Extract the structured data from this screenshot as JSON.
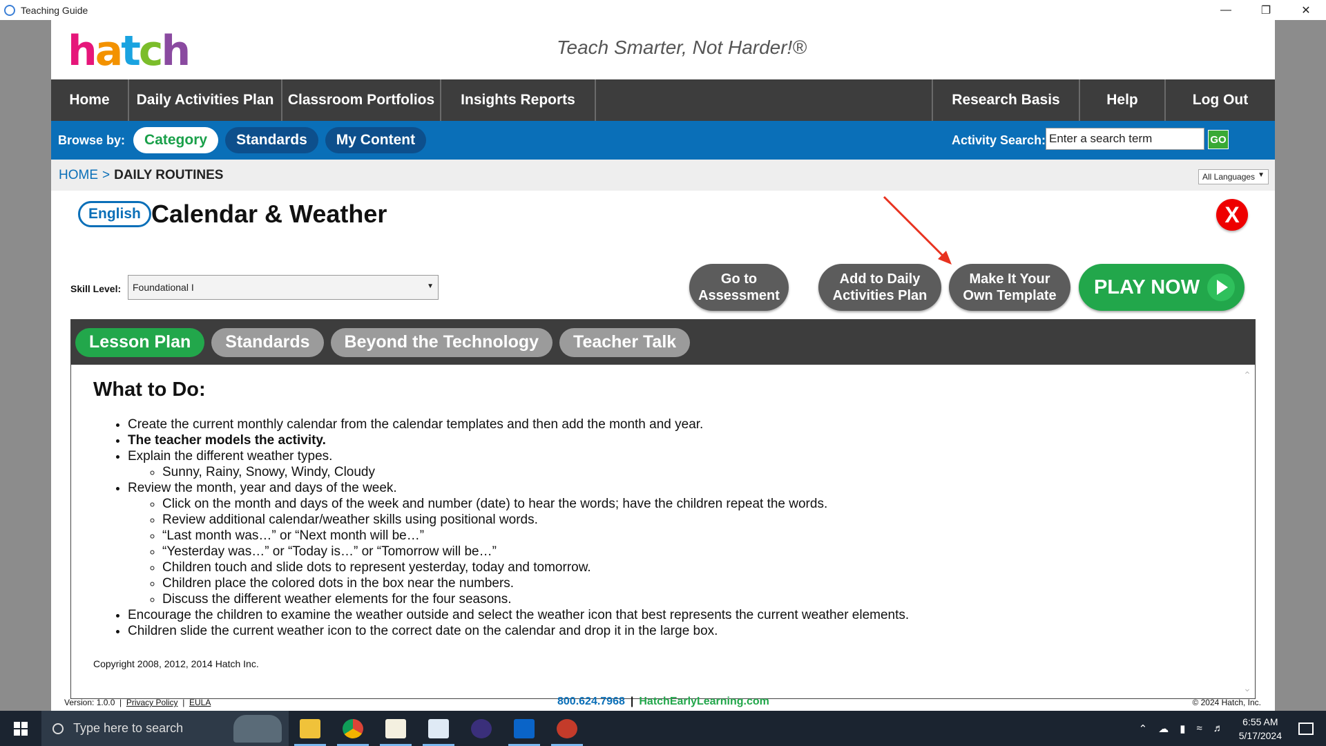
{
  "window": {
    "title": "Teaching Guide",
    "controls": [
      "—",
      "❐",
      "✕"
    ]
  },
  "header": {
    "logo_letters": [
      "h",
      "a",
      "t",
      "c",
      "h"
    ],
    "tagline": "Teach Smarter, Not Harder!®"
  },
  "main_nav": {
    "items_left": [
      "Home",
      "Daily Activities Plan",
      "Classroom Portfolios",
      "Insights Reports"
    ],
    "items_right": [
      "Research Basis",
      "Help",
      "Log Out"
    ]
  },
  "browse": {
    "label": "Browse by:",
    "pills": [
      "Category",
      "Standards",
      "My Content"
    ],
    "active_pill": "Category",
    "search_label": "Activity Search:",
    "search_value": "Enter a search term",
    "go_label": "GO"
  },
  "breadcrumb": {
    "home": "HOME",
    "separator": ">",
    "current": "DAILY ROUTINES",
    "language_select": "All Languages"
  },
  "activity": {
    "language_badge": "English",
    "title": "Calendar & Weather",
    "close_label": "X",
    "skill_label": "Skill Level:",
    "skill_value": "Foundational I",
    "buttons": {
      "assessment": [
        "Go to",
        "Assessment"
      ],
      "add_daily": [
        "Add to Daily",
        "Activities Plan"
      ],
      "template": [
        "Make It Your",
        "Own Template"
      ],
      "play": "PLAY NOW"
    }
  },
  "tabs": [
    "Lesson Plan",
    "Standards",
    "Beyond the Technology",
    "Teacher Talk"
  ],
  "lesson": {
    "heading": "What to Do:",
    "items": [
      "Create the current monthly calendar from the calendar templates and then add the month and year.",
      "The teacher models the activity.",
      "Explain the different weather types.",
      "Review the month, year and days of the week.",
      "Encourage the children to examine the weather outside and select the weather icon that best represents the current weather elements.",
      "Children slide the current weather icon to the correct date on the calendar and drop it in the large box."
    ],
    "weather_subitems": [
      "Sunny, Rainy, Snowy, Windy, Cloudy"
    ],
    "review_subitems": [
      "Click on the month and days of the week and number (date) to hear the words; have the children repeat the words.",
      "Review additional calendar/weather skills using positional words.",
      "“Last month was…” or “Next month will be…”",
      "“Yesterday was…” or “Today is…” or “Tomorrow will be…”",
      "Children touch and slide dots to represent yesterday, today and tomorrow.",
      "Children place the colored dots in the box near the numbers.",
      "Discuss the different weather elements for the four seasons."
    ],
    "copyright": "Copyright 2008, 2012, 2014 Hatch Inc."
  },
  "footer": {
    "version": "Version: 1.0.0",
    "privacy": "Privacy Policy",
    "eula": "EULA",
    "phone": "800.624.7968",
    "website": "HatchEarlyLearning.com",
    "copyright": "© 2024 Hatch, Inc."
  },
  "taskbar": {
    "search_placeholder": "Type here to search",
    "time": "6:55 AM",
    "date": "5/17/2024"
  },
  "colors": {
    "nav_dark": "#3d3d3d",
    "brand_blue": "#0a6fb8",
    "brand_green": "#22a74b",
    "close_red": "#e00000",
    "annotation_arrow": "#e8321f"
  }
}
